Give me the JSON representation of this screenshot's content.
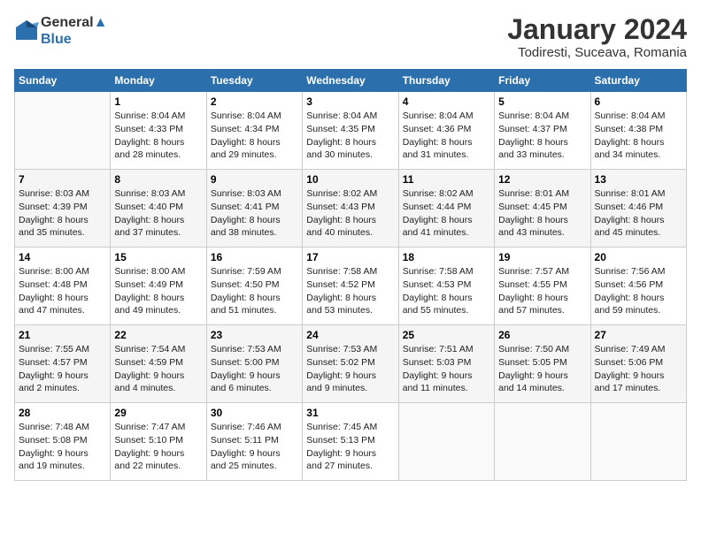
{
  "header": {
    "logo_line1": "General",
    "logo_line2": "Blue",
    "month_year": "January 2024",
    "location": "Todiresti, Suceava, Romania"
  },
  "weekdays": [
    "Sunday",
    "Monday",
    "Tuesday",
    "Wednesday",
    "Thursday",
    "Friday",
    "Saturday"
  ],
  "weeks": [
    [
      {
        "day": "",
        "detail": ""
      },
      {
        "day": "1",
        "detail": "Sunrise: 8:04 AM\nSunset: 4:33 PM\nDaylight: 8 hours\nand 28 minutes."
      },
      {
        "day": "2",
        "detail": "Sunrise: 8:04 AM\nSunset: 4:34 PM\nDaylight: 8 hours\nand 29 minutes."
      },
      {
        "day": "3",
        "detail": "Sunrise: 8:04 AM\nSunset: 4:35 PM\nDaylight: 8 hours\nand 30 minutes."
      },
      {
        "day": "4",
        "detail": "Sunrise: 8:04 AM\nSunset: 4:36 PM\nDaylight: 8 hours\nand 31 minutes."
      },
      {
        "day": "5",
        "detail": "Sunrise: 8:04 AM\nSunset: 4:37 PM\nDaylight: 8 hours\nand 33 minutes."
      },
      {
        "day": "6",
        "detail": "Sunrise: 8:04 AM\nSunset: 4:38 PM\nDaylight: 8 hours\nand 34 minutes."
      }
    ],
    [
      {
        "day": "7",
        "detail": "Sunrise: 8:03 AM\nSunset: 4:39 PM\nDaylight: 8 hours\nand 35 minutes."
      },
      {
        "day": "8",
        "detail": "Sunrise: 8:03 AM\nSunset: 4:40 PM\nDaylight: 8 hours\nand 37 minutes."
      },
      {
        "day": "9",
        "detail": "Sunrise: 8:03 AM\nSunset: 4:41 PM\nDaylight: 8 hours\nand 38 minutes."
      },
      {
        "day": "10",
        "detail": "Sunrise: 8:02 AM\nSunset: 4:43 PM\nDaylight: 8 hours\nand 40 minutes."
      },
      {
        "day": "11",
        "detail": "Sunrise: 8:02 AM\nSunset: 4:44 PM\nDaylight: 8 hours\nand 41 minutes."
      },
      {
        "day": "12",
        "detail": "Sunrise: 8:01 AM\nSunset: 4:45 PM\nDaylight: 8 hours\nand 43 minutes."
      },
      {
        "day": "13",
        "detail": "Sunrise: 8:01 AM\nSunset: 4:46 PM\nDaylight: 8 hours\nand 45 minutes."
      }
    ],
    [
      {
        "day": "14",
        "detail": "Sunrise: 8:00 AM\nSunset: 4:48 PM\nDaylight: 8 hours\nand 47 minutes."
      },
      {
        "day": "15",
        "detail": "Sunrise: 8:00 AM\nSunset: 4:49 PM\nDaylight: 8 hours\nand 49 minutes."
      },
      {
        "day": "16",
        "detail": "Sunrise: 7:59 AM\nSunset: 4:50 PM\nDaylight: 8 hours\nand 51 minutes."
      },
      {
        "day": "17",
        "detail": "Sunrise: 7:58 AM\nSunset: 4:52 PM\nDaylight: 8 hours\nand 53 minutes."
      },
      {
        "day": "18",
        "detail": "Sunrise: 7:58 AM\nSunset: 4:53 PM\nDaylight: 8 hours\nand 55 minutes."
      },
      {
        "day": "19",
        "detail": "Sunrise: 7:57 AM\nSunset: 4:55 PM\nDaylight: 8 hours\nand 57 minutes."
      },
      {
        "day": "20",
        "detail": "Sunrise: 7:56 AM\nSunset: 4:56 PM\nDaylight: 8 hours\nand 59 minutes."
      }
    ],
    [
      {
        "day": "21",
        "detail": "Sunrise: 7:55 AM\nSunset: 4:57 PM\nDaylight: 9 hours\nand 2 minutes."
      },
      {
        "day": "22",
        "detail": "Sunrise: 7:54 AM\nSunset: 4:59 PM\nDaylight: 9 hours\nand 4 minutes."
      },
      {
        "day": "23",
        "detail": "Sunrise: 7:53 AM\nSunset: 5:00 PM\nDaylight: 9 hours\nand 6 minutes."
      },
      {
        "day": "24",
        "detail": "Sunrise: 7:53 AM\nSunset: 5:02 PM\nDaylight: 9 hours\nand 9 minutes."
      },
      {
        "day": "25",
        "detail": "Sunrise: 7:51 AM\nSunset: 5:03 PM\nDaylight: 9 hours\nand 11 minutes."
      },
      {
        "day": "26",
        "detail": "Sunrise: 7:50 AM\nSunset: 5:05 PM\nDaylight: 9 hours\nand 14 minutes."
      },
      {
        "day": "27",
        "detail": "Sunrise: 7:49 AM\nSunset: 5:06 PM\nDaylight: 9 hours\nand 17 minutes."
      }
    ],
    [
      {
        "day": "28",
        "detail": "Sunrise: 7:48 AM\nSunset: 5:08 PM\nDaylight: 9 hours\nand 19 minutes."
      },
      {
        "day": "29",
        "detail": "Sunrise: 7:47 AM\nSunset: 5:10 PM\nDaylight: 9 hours\nand 22 minutes."
      },
      {
        "day": "30",
        "detail": "Sunrise: 7:46 AM\nSunset: 5:11 PM\nDaylight: 9 hours\nand 25 minutes."
      },
      {
        "day": "31",
        "detail": "Sunrise: 7:45 AM\nSunset: 5:13 PM\nDaylight: 9 hours\nand 27 minutes."
      },
      {
        "day": "",
        "detail": ""
      },
      {
        "day": "",
        "detail": ""
      },
      {
        "day": "",
        "detail": ""
      }
    ]
  ]
}
